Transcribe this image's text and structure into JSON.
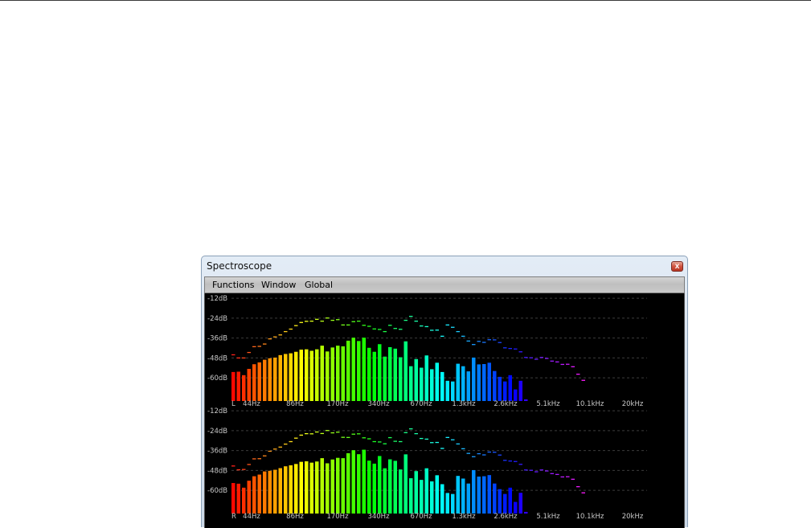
{
  "window": {
    "title": "Spectroscope",
    "close_glyph": "x"
  },
  "menu": {
    "items": [
      "Functions",
      "Window",
      "Global"
    ]
  },
  "chart_data": [
    {
      "type": "bar",
      "channel_label": "L",
      "y_tick_labels": [
        "-12dB",
        "-24dB",
        "-36dB",
        "-48dB",
        "-60dB"
      ],
      "y_ticks": [
        -12,
        -24,
        -36,
        -48,
        -60
      ],
      "ylim": [
        -74,
        -10
      ],
      "x_tick_labels": [
        "44Hz",
        "86Hz",
        "170Hz",
        "340Hz",
        "670Hz",
        "1.3kHz",
        "2.6kHz",
        "5.1kHz",
        "10.1kHz",
        "20kHz"
      ],
      "values": [
        -56.5,
        -56.3,
        -58.4,
        -54.6,
        -51.8,
        -50.7,
        -49.1,
        -48.2,
        -47.8,
        -46.3,
        -45.6,
        -45.2,
        -44.3,
        -43.0,
        -42.8,
        -43.7,
        -42.8,
        -40.6,
        -44.1,
        -41.7,
        -40.6,
        -41.0,
        -37.6,
        -35.8,
        -37.8,
        -35.8,
        -41.9,
        -44.3,
        -39.7,
        -47.2,
        -41.5,
        -42.4,
        -47.6,
        -38.0,
        -53.0,
        -48.7,
        -53.9,
        -46.5,
        -54.8,
        -50.9,
        -56.5,
        -61.8,
        -62.2,
        -51.5,
        -53.0,
        -56.1,
        -47.8,
        -51.9,
        -51.7,
        -50.9,
        -55.9,
        -59.4,
        -62.2,
        -58.4,
        -67.0,
        -61.8,
        -73.0
      ],
      "peaks": [
        -45.8,
        -47.7,
        -47.7,
        -44.4,
        -40.9,
        -40.7,
        -39.3,
        -36.2,
        -35.0,
        -33.8,
        -31.8,
        -30.3,
        -28.2,
        -26.3,
        -25.6,
        -25.5,
        -24.4,
        -25.5,
        -23.6,
        -25.0,
        -24.6,
        -27.8,
        -27.8,
        -25.8,
        -25.5,
        -28.0,
        -28.6,
        -30.2,
        -30.5,
        -31.8,
        -28.0,
        -29.9,
        -30.4,
        -25.0,
        -22.6,
        -25.5,
        -28.4,
        -28.8,
        -31.0,
        -30.9,
        -34.6,
        -27.8,
        -29.2,
        -31.8,
        -34.6,
        -37.5,
        -39.6,
        -37.7,
        -38.3,
        -36.7,
        -36.8,
        -38.4,
        -41.6,
        -42.0,
        -42.3,
        -44.0,
        -47.4,
        -47.6,
        -48.5,
        -47.4,
        -48.0,
        -49.6,
        -50.1,
        -51.6,
        -51.5,
        -53.0,
        -57.5,
        -61.2
      ]
    },
    {
      "type": "bar",
      "channel_label": "R",
      "y_tick_labels": [
        "-12dB",
        "-24dB",
        "-36dB",
        "-48dB",
        "-60dB"
      ],
      "y_ticks": [
        -12,
        -24,
        -36,
        -48,
        -60
      ],
      "ylim": [
        -74,
        -10
      ],
      "x_tick_labels": [
        "44Hz",
        "86Hz",
        "170Hz",
        "340Hz",
        "670Hz",
        "1.3kHz",
        "2.6kHz",
        "5.1kHz",
        "10.1kHz",
        "20kHz"
      ],
      "values": [
        -55.6,
        -56.0,
        -58.4,
        -54.2,
        -51.5,
        -50.5,
        -48.6,
        -48.2,
        -47.6,
        -46.6,
        -45.5,
        -44.9,
        -44.1,
        -42.8,
        -42.5,
        -43.3,
        -42.6,
        -40.6,
        -43.7,
        -41.4,
        -40.4,
        -40.6,
        -37.6,
        -35.8,
        -38.2,
        -35.5,
        -42.1,
        -43.9,
        -39.3,
        -46.7,
        -41.3,
        -42.2,
        -47.4,
        -38.3,
        -52.7,
        -48.4,
        -53.7,
        -46.7,
        -54.6,
        -50.9,
        -56.3,
        -61.6,
        -62.2,
        -51.3,
        -52.9,
        -55.9,
        -47.8,
        -51.7,
        -51.5,
        -50.8,
        -55.9,
        -59.3,
        -62.2,
        -58.4,
        -67.0,
        -61.5,
        -73.0
      ],
      "peaks": [
        -45.0,
        -47.3,
        -47.1,
        -44.1,
        -40.7,
        -40.6,
        -38.9,
        -36.1,
        -34.8,
        -33.6,
        -31.8,
        -30.3,
        -28.2,
        -26.4,
        -25.5,
        -25.6,
        -24.5,
        -25.4,
        -23.6,
        -25.0,
        -24.6,
        -27.7,
        -27.8,
        -25.8,
        -25.6,
        -28.0,
        -28.6,
        -30.3,
        -30.5,
        -31.6,
        -27.9,
        -30.1,
        -30.3,
        -24.9,
        -22.6,
        -25.5,
        -28.4,
        -28.8,
        -30.9,
        -30.8,
        -34.4,
        -27.8,
        -29.2,
        -31.7,
        -34.6,
        -37.4,
        -39.4,
        -37.6,
        -38.3,
        -36.6,
        -36.7,
        -38.4,
        -41.6,
        -42.0,
        -42.3,
        -44.0,
        -47.4,
        -47.6,
        -48.5,
        -47.4,
        -48.0,
        -49.6,
        -50.1,
        -51.6,
        -51.5,
        -53.0,
        -57.5,
        -61.2
      ]
    }
  ]
}
